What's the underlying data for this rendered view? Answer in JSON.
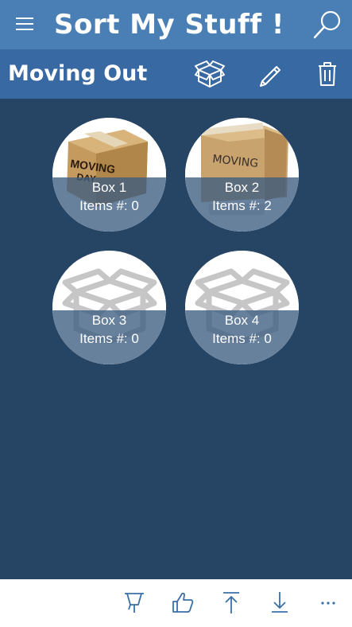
{
  "header": {
    "title": "Sort My Stuff !"
  },
  "subheader": {
    "title": "Moving Out"
  },
  "boxes": [
    {
      "name": "Box 1",
      "items": "Items #: 0",
      "image": "moving-day-box-photo"
    },
    {
      "name": "Box 2",
      "items": "Items #: 2",
      "image": "moving-box-photo"
    },
    {
      "name": "Box 3",
      "items": "Items #: 0",
      "image": "open-box-placeholder"
    },
    {
      "name": "Box 4",
      "items": "Items #: 0",
      "image": "open-box-placeholder"
    }
  ],
  "icons": {
    "menu": "hamburger-icon",
    "search": "search-icon",
    "add_box": "box-icon",
    "edit": "pencil-icon",
    "delete": "trash-icon",
    "pin": "pin-icon",
    "like": "thumbs-up-icon",
    "upload": "upload-icon",
    "download": "download-icon",
    "more": "more-icon"
  },
  "colors": {
    "background": "#264565",
    "topbar": "#4a7fb5",
    "subbar": "#3869a3",
    "appbar": "#ffffff",
    "appbar_icon": "#3a6fa8"
  }
}
